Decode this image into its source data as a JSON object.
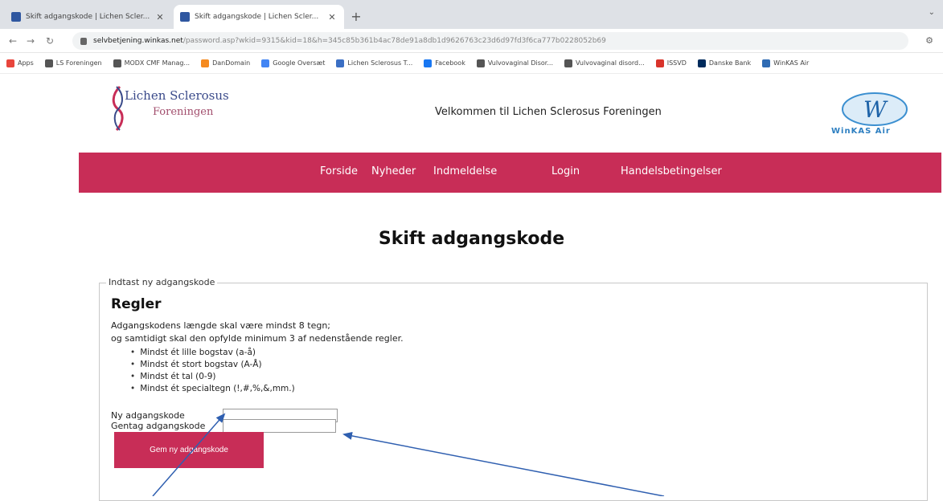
{
  "browser": {
    "tabs": [
      {
        "title": "Skift adgangskode | Lichen Scler...",
        "active": false
      },
      {
        "title": "Skift adgangskode | Lichen Scler...",
        "active": true
      }
    ],
    "new_tab_symbol": "+",
    "url_host": "selvbetjening.winkas.net",
    "url_path": "/password.asp?wkid=9315&kid=18&h=345c85b361b4ac78de91a8db1d9626763c23d6d97fd3f6ca777b0228052b69",
    "bookmarks": [
      {
        "label": "Apps",
        "icon": "apps-grid-icon",
        "color": "#e8453c"
      },
      {
        "label": "LS Foreningen",
        "icon": "globe-icon",
        "color": "#555555"
      },
      {
        "label": "MODX CMF Manag...",
        "icon": "globe-icon",
        "color": "#555555"
      },
      {
        "label": "DanDomain",
        "icon": "dandomain-icon",
        "color": "#f58a1f"
      },
      {
        "label": "Google Oversæt",
        "icon": "translate-icon",
        "color": "#4285f4"
      },
      {
        "label": "Lichen Sclerosus T...",
        "icon": "bookmark-icon",
        "color": "#3b6fc4"
      },
      {
        "label": "Facebook",
        "icon": "facebook-icon",
        "color": "#1877f2"
      },
      {
        "label": "Vulvovaginal Disor...",
        "icon": "globe-icon",
        "color": "#555555"
      },
      {
        "label": "Vulvovaginal disord...",
        "icon": "globe-icon",
        "color": "#555555"
      },
      {
        "label": "ISSVD",
        "icon": "issvd-icon",
        "color": "#d9342b"
      },
      {
        "label": "Danske Bank",
        "icon": "bank-icon",
        "color": "#002b5c"
      },
      {
        "label": "WinKAS Air",
        "icon": "winkas-icon",
        "color": "#2f6bb3"
      }
    ]
  },
  "header": {
    "logo_line1": "Lichen Sclerosus",
    "logo_line2": "Foreningen",
    "welcome": "Velkommen til Lichen Sclerosus Foreningen",
    "partner_logo_text": "WinKAS Air"
  },
  "nav": {
    "items": [
      "Forside",
      "Nyheder",
      "Indmeldelse",
      "Login",
      "Handelsbetingelser"
    ]
  },
  "page": {
    "title": "Skift adgangskode"
  },
  "form": {
    "legend": "Indtast ny adgangskode",
    "rules_heading": "Regler",
    "rules_intro1": "Adgangskodens længde skal være mindst 8 tegn;",
    "rules_intro2": "og samtidigt skal den opfylde minimum 3 af nedenstående regler.",
    "rules": [
      "Mindst ét lille bogstav (a-å)",
      "Mindst ét stort bogstav (A-Å)",
      "Mindst ét tal (0-9)",
      "Mindst ét specialtegn (!,#,%,&,mm.)"
    ],
    "new_password_label": "Ny adgangskode",
    "new_password_value": "",
    "repeat_password_label": "Gentag adgangskode",
    "repeat_password_value": "",
    "save_label": "Gem ny adgangskode"
  },
  "colors": {
    "accent": "#c82d57",
    "annotation_arrow": "#2f5fb0"
  }
}
